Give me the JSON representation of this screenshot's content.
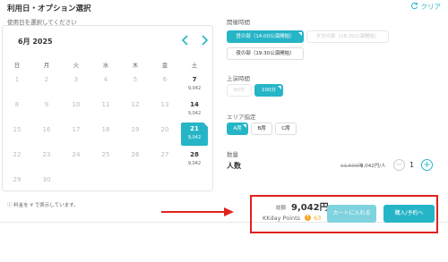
{
  "header": {
    "title": "利用日・オプション選択",
    "clear_label": "クリア"
  },
  "calendar_section": {
    "label": "使用日を選択してください"
  },
  "calendar": {
    "month_label": "6月 2025",
    "weekdays": [
      "日",
      "月",
      "火",
      "水",
      "木",
      "金",
      "土"
    ],
    "weeks": [
      [
        {
          "d": "1"
        },
        {
          "d": "2"
        },
        {
          "d": "3"
        },
        {
          "d": "4"
        },
        {
          "d": "5"
        },
        {
          "d": "6"
        },
        {
          "d": "7",
          "p": "9,042"
        }
      ],
      [
        {
          "d": "8"
        },
        {
          "d": "9"
        },
        {
          "d": "10"
        },
        {
          "d": "11"
        },
        {
          "d": "12"
        },
        {
          "d": "13"
        },
        {
          "d": "14",
          "p": "9,042"
        }
      ],
      [
        {
          "d": "15"
        },
        {
          "d": "16"
        },
        {
          "d": "17"
        },
        {
          "d": "18"
        },
        {
          "d": "19"
        },
        {
          "d": "20"
        },
        {
          "d": "21",
          "p": "9,042",
          "selected": true
        }
      ],
      [
        {
          "d": "22"
        },
        {
          "d": "23"
        },
        {
          "d": "24"
        },
        {
          "d": "25"
        },
        {
          "d": "26"
        },
        {
          "d": "27"
        },
        {
          "d": "28",
          "p": "9,042"
        }
      ],
      [
        {
          "d": "29"
        },
        {
          "d": "30"
        }
      ]
    ],
    "note": "ⓘ 料金を ¥ で表示しています。"
  },
  "options": {
    "session": {
      "label": "開催時間",
      "items": [
        {
          "label": "昼の部（14:00公演開始）",
          "state": "selected"
        },
        {
          "label": "夕方の部（16:30公演開始）",
          "state": "disabled"
        },
        {
          "label": "夜の部（19:30公演開始）",
          "state": "normal"
        }
      ]
    },
    "duration": {
      "label": "上演時間",
      "items": [
        {
          "label": "60分",
          "state": "disabled"
        },
        {
          "label": "100分",
          "state": "selected"
        }
      ]
    },
    "area": {
      "label": "エリア指定",
      "items": [
        {
          "label": "A席",
          "state": "selected"
        },
        {
          "label": "B席",
          "state": "normal"
        },
        {
          "label": "C席",
          "state": "normal"
        }
      ]
    }
  },
  "quantity": {
    "label": "数量",
    "person_label": "人数",
    "old_price": "11,600円",
    "unit_price": "9,042円/人",
    "minus": "−",
    "plus": "+",
    "value": "1"
  },
  "checkout": {
    "total_label": "総額",
    "total_price": "9,042円",
    "points_label": "KKday Points",
    "coin_symbol": "!",
    "points_value": "63",
    "cart_button": "カートに入れる",
    "book_button": "購入/予約へ"
  },
  "colors": {
    "accent": "#26b5c7",
    "accent_light": "#7fd3de",
    "highlight_box": "#e0211d",
    "points": "#f5a623"
  }
}
